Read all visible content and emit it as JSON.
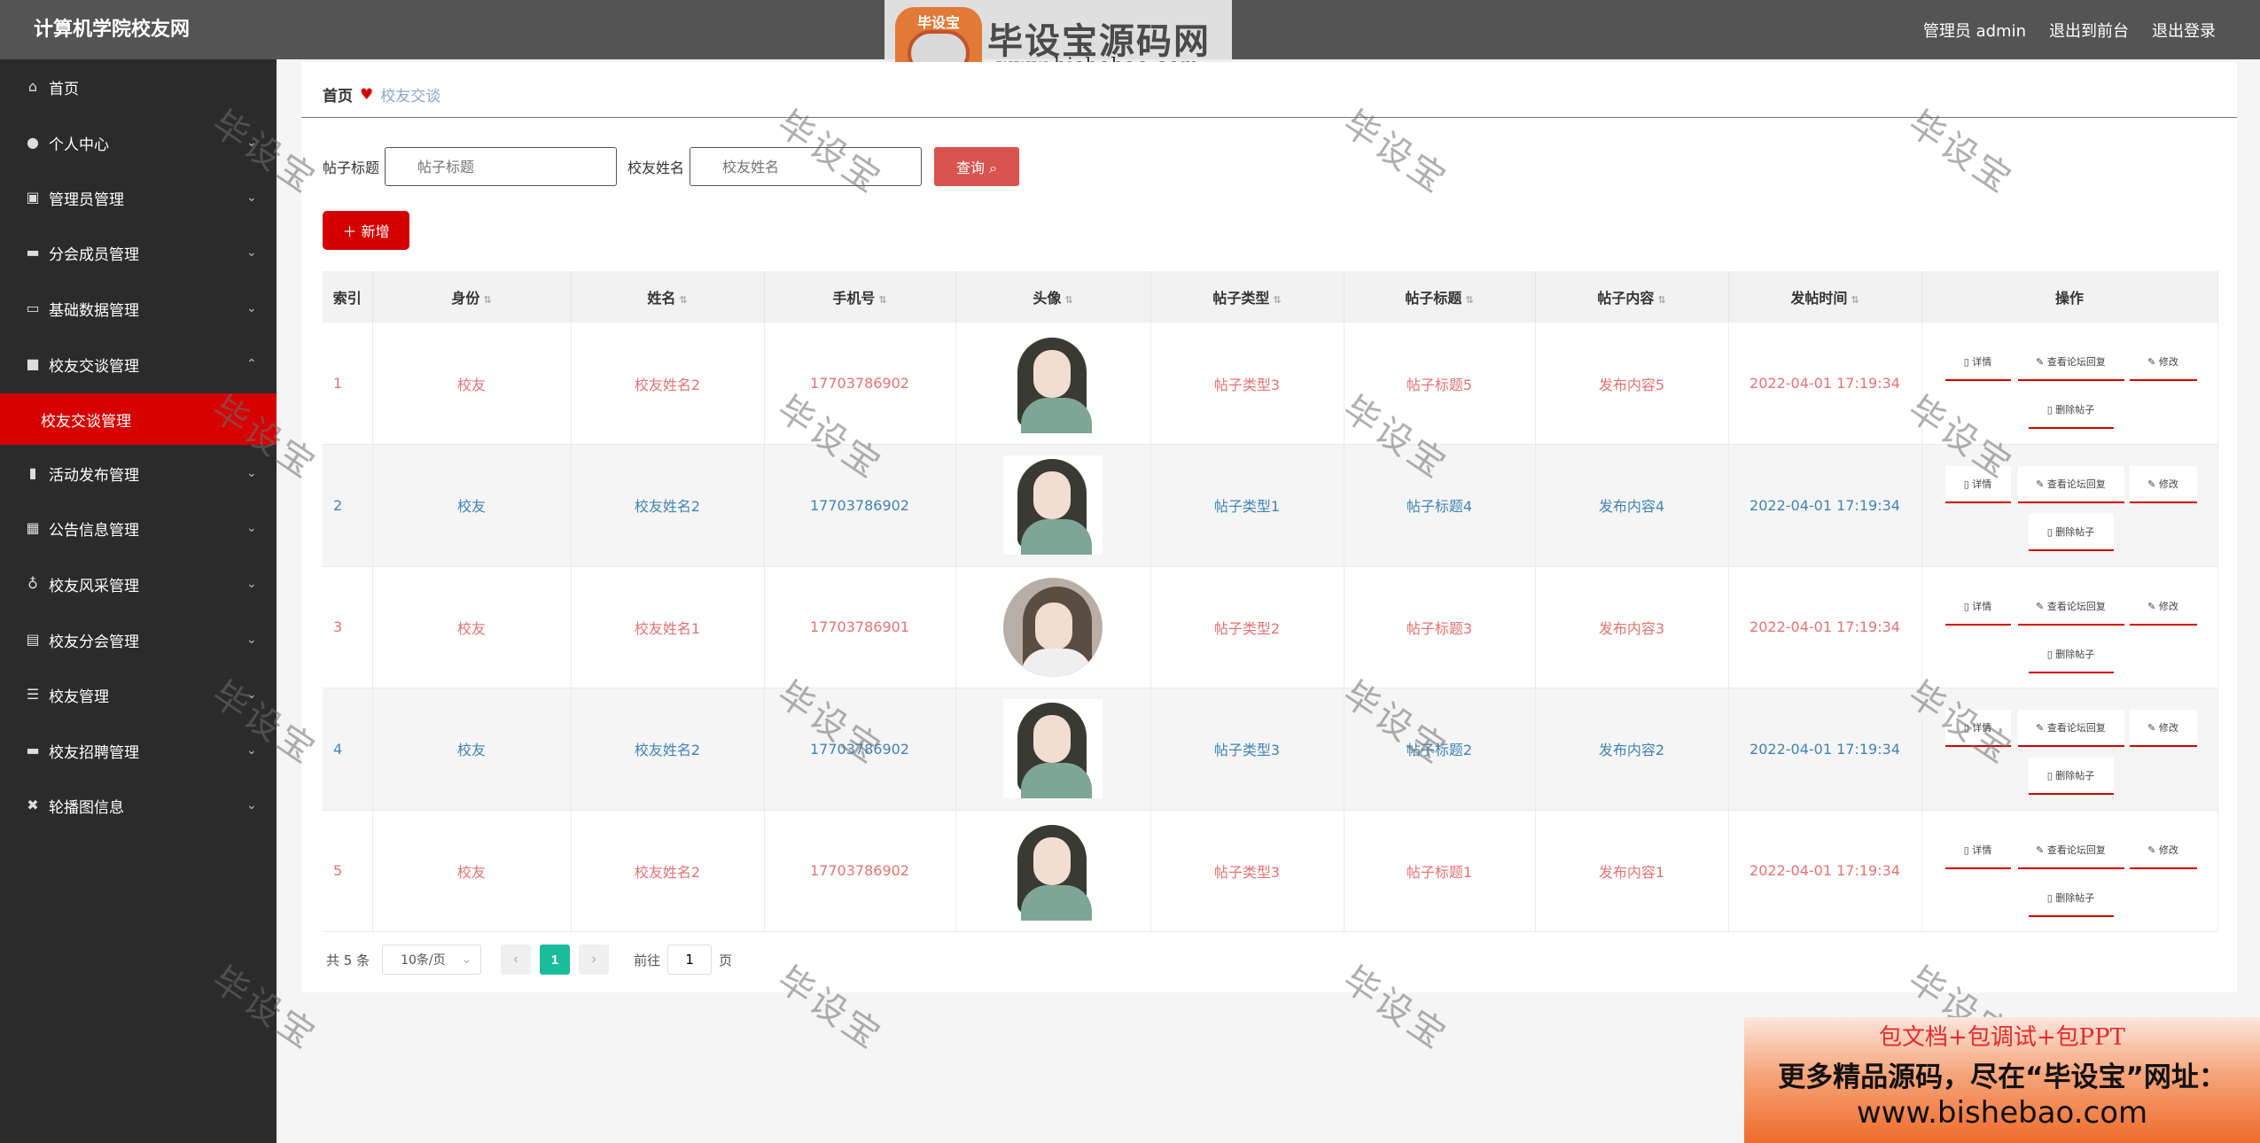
{
  "app": {
    "title": "计算机学院校友网"
  },
  "header": {
    "admin_label": "管理员 admin",
    "front_label": "退出到前台",
    "logout_label": "退出登录"
  },
  "watermark_logo": {
    "badge": "毕设宝",
    "title": "毕设宝源码网",
    "url": "www.bishebao.com"
  },
  "watermark_text": "毕设宝",
  "sidebar": {
    "items": [
      {
        "label": "首页",
        "icon": "home-icon"
      },
      {
        "label": "个人中心",
        "icon": "user-icon"
      },
      {
        "label": "管理员管理",
        "icon": "admin-icon"
      },
      {
        "label": "分会成员管理",
        "icon": "chat-icon"
      },
      {
        "label": "基础数据管理",
        "icon": "data-icon"
      },
      {
        "label": "校友交谈管理",
        "icon": "briefcase-icon"
      },
      {
        "label": "活动发布管理",
        "icon": "chart-icon"
      },
      {
        "label": "公告信息管理",
        "icon": "grid-icon"
      },
      {
        "label": "校友风采管理",
        "icon": "mic-icon"
      },
      {
        "label": "校友分会管理",
        "icon": "clipboard-icon"
      },
      {
        "label": "校友管理",
        "icon": "list-icon"
      },
      {
        "label": "校友招聘管理",
        "icon": "monitor-icon"
      },
      {
        "label": "轮播图信息",
        "icon": "carousel-icon"
      }
    ],
    "active_sub": "校友交谈管理"
  },
  "breadcrumb": {
    "home": "首页",
    "current": "校友交谈"
  },
  "search": {
    "title_label": "帖子标题",
    "title_placeholder": "帖子标题",
    "name_label": "校友姓名",
    "name_placeholder": "校友姓名",
    "query_button": "查询"
  },
  "add_button": "新增",
  "table": {
    "headers": [
      "索引",
      "身份",
      "姓名",
      "手机号",
      "头像",
      "帖子类型",
      "帖子标题",
      "帖子内容",
      "发帖时间",
      "操作"
    ],
    "rows": [
      {
        "index": "1",
        "identity": "校友",
        "name": "校友姓名2",
        "phone": "17703786902",
        "type": "帖子类型3",
        "title": "帖子标题5",
        "content": "发布内容5",
        "time": "2022-04-01 17:19:34"
      },
      {
        "index": "2",
        "identity": "校友",
        "name": "校友姓名2",
        "phone": "17703786902",
        "type": "帖子类型1",
        "title": "帖子标题4",
        "content": "发布内容4",
        "time": "2022-04-01 17:19:34"
      },
      {
        "index": "3",
        "identity": "校友",
        "name": "校友姓名1",
        "phone": "17703786901",
        "type": "帖子类型2",
        "title": "帖子标题3",
        "content": "发布内容3",
        "time": "2022-04-01 17:19:34"
      },
      {
        "index": "4",
        "identity": "校友",
        "name": "校友姓名2",
        "phone": "17703786902",
        "type": "帖子类型3",
        "title": "帖子标题2",
        "content": "发布内容2",
        "time": "2022-04-01 17:19:34"
      },
      {
        "index": "5",
        "identity": "校友",
        "name": "校友姓名2",
        "phone": "17703786902",
        "type": "帖子类型3",
        "title": "帖子标题1",
        "content": "发布内容1",
        "time": "2022-04-01 17:19:34"
      }
    ],
    "ops": {
      "detail": "详情",
      "reply": "查看论坛回复",
      "edit": "修改",
      "delete": "删除帖子"
    }
  },
  "pagination": {
    "total": "共 5 条",
    "page_size": "10条/页",
    "current_page": "1",
    "goto_prefix": "前往",
    "goto_value": "1",
    "goto_suffix": "页"
  },
  "promo": {
    "line1": "包文档+包调试+包PPT",
    "line2": "更多精品源码，尽在“毕设宝”网址：",
    "line3": "www.bishebao.com"
  }
}
